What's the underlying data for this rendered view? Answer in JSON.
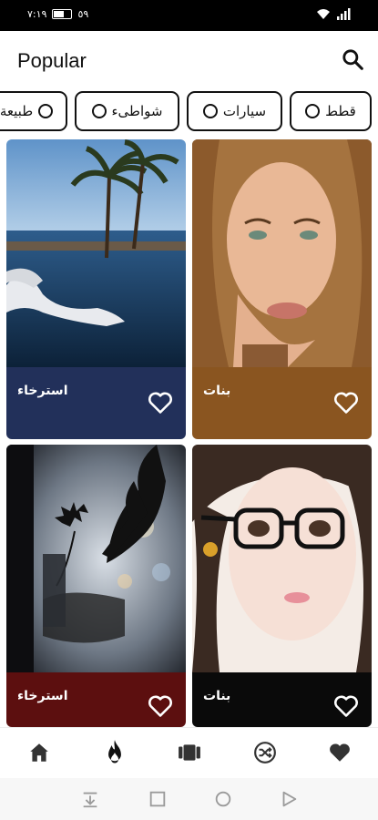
{
  "status_bar": {
    "time": "٧:١٩",
    "battery": "٥٩"
  },
  "app_bar": {
    "title": "Popular",
    "search_icon": "search-icon"
  },
  "chips": [
    {
      "label": "طبيعة"
    },
    {
      "label": "شواطىء"
    },
    {
      "label": "سيارات"
    },
    {
      "label": "قطط"
    }
  ],
  "cards": [
    {
      "caption": "استرخاء",
      "footer_color": "#22305a"
    },
    {
      "caption": "بنات",
      "footer_color": "#8a5520"
    },
    {
      "caption": "استرخاء",
      "footer_color": "#5c0f0f"
    },
    {
      "caption": "بنات",
      "footer_color": "#0a0a0a"
    }
  ],
  "bottom_nav": {
    "items": [
      {
        "icon": "home-icon"
      },
      {
        "icon": "fire-icon",
        "active": true
      },
      {
        "icon": "gallery-icon"
      },
      {
        "icon": "shuffle-icon"
      },
      {
        "icon": "heart-icon"
      }
    ]
  },
  "system_nav": {
    "icons": [
      "download-icon",
      "square-icon",
      "circle-icon",
      "back-triangle-icon"
    ]
  }
}
